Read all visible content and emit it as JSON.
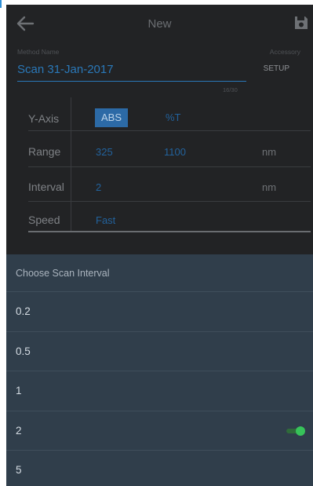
{
  "appbar": {
    "title": "New",
    "back_icon": "arrow-left-icon",
    "save_icon": "floppy-disk-icon"
  },
  "method": {
    "label": "Method Name",
    "value": "Scan 31-Jan-2017",
    "counter": "16/30"
  },
  "accessory": {
    "label": "Accessory",
    "setup_label": "SETUP"
  },
  "params": {
    "yaxis": {
      "label": "Y-Axis",
      "abs": "ABS",
      "pct": "%T",
      "selected": "ABS"
    },
    "range": {
      "label": "Range",
      "start": "325",
      "end": "1100",
      "unit": "nm"
    },
    "interval": {
      "label": "Interval",
      "value": "2",
      "unit": "nm"
    },
    "speed": {
      "label": "Speed",
      "value": "Fast"
    }
  },
  "chooser": {
    "title": "Choose Scan Interval",
    "options": [
      "0.2",
      "0.5",
      "1",
      "2",
      "5"
    ],
    "selected": "2"
  },
  "colors": {
    "background": "#222325",
    "accent_blue": "#2a78b8",
    "panel": "#303e4b",
    "selected_indicator": "#37c35a"
  }
}
